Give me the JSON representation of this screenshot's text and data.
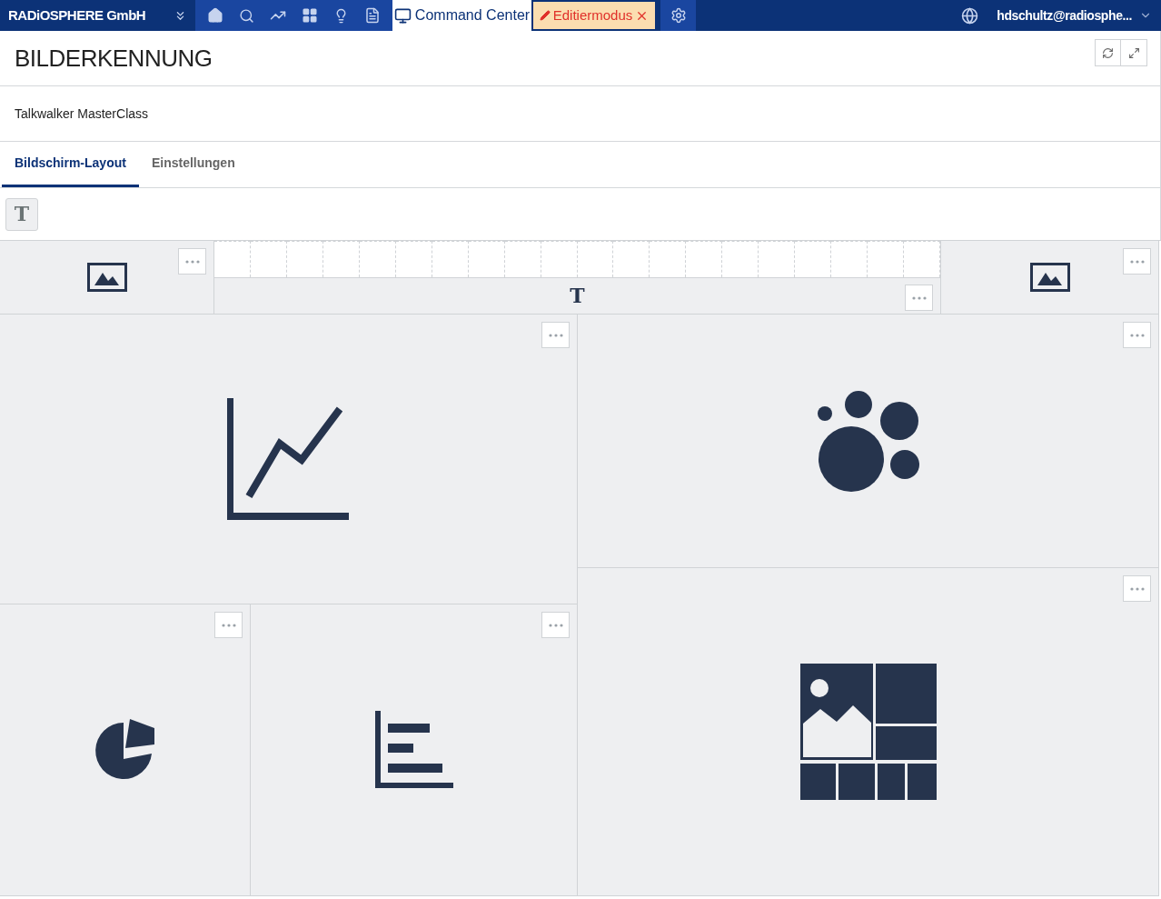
{
  "navbar": {
    "brand": "RADiOSPHERE GmbH",
    "active_tab": {
      "label": "Command Center",
      "selected": true
    },
    "edit_mode": {
      "label": "Editiermodus"
    },
    "user": "hdschultz@radiosphe..."
  },
  "header": {
    "title": "BILDERKENNUNG",
    "subtitle": "Talkwalker MasterClass"
  },
  "tabs": [
    {
      "label": "Bildschirm-Layout",
      "selected": true
    },
    {
      "label": "Einstellungen",
      "selected": false
    }
  ],
  "toolbar": {
    "text_tool": "T"
  },
  "widgets": [
    {
      "kind": "image"
    },
    {
      "kind": "text",
      "label": "T"
    },
    {
      "kind": "image"
    },
    {
      "kind": "line"
    },
    {
      "kind": "bubble"
    },
    {
      "kind": "mosaic"
    },
    {
      "kind": "pie"
    },
    {
      "kind": "bar"
    }
  ]
}
